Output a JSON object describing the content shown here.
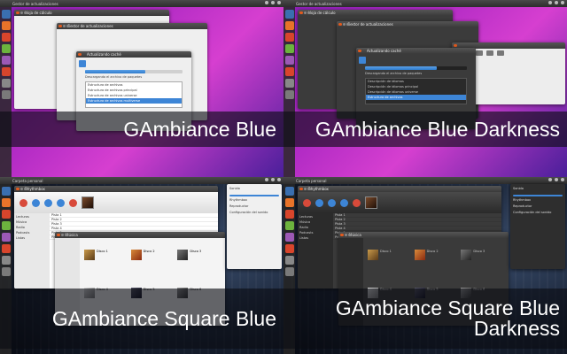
{
  "quadrants": [
    {
      "caption": "GAmbiance Blue",
      "panel_title": "Gestor de actualizaciones",
      "theme": "light",
      "accent": "#3d85d6",
      "window_back_title": "Hoja de cálculo",
      "window_front_title": "Gestor de actualizaciones",
      "dialog_title": "Actualizando caché",
      "dialog_line": "Descargando el archivo de paquetes",
      "list_rows": [
        "Estructura de archivos",
        "Estructura de archivos principal",
        "Estructura de archivos universe",
        "Estructura de archivos multiverse"
      ]
    },
    {
      "caption": "GAmbiance Blue Darkness",
      "panel_title": "Gestor de actualizaciones",
      "theme": "dark",
      "accent": "#3d85d6",
      "window_back_title": "Hoja de cálculo",
      "window_front_title": "Gestor de actualizaciones",
      "dialog_title": "Actualizando caché",
      "dialog_line": "Descargando el archivo de paquetes",
      "list_rows": [
        "Descripción de idiomas",
        "Descripción de idiomas principal",
        "Descripción de idiomas universe",
        "Estructura de archivos"
      ]
    },
    {
      "caption": "GAmbiance Square Blue",
      "panel_title": "Carpeta personal",
      "theme": "light",
      "accent": "#3d85d6",
      "player_title": "Rhythmbox",
      "files_title": "Música",
      "sidebar_rows": [
        "Lecturas",
        "Música",
        "Radio",
        "Podcasts",
        "Listas"
      ],
      "tracks": [
        "Pista 1",
        "Pista 2",
        "Pista 3",
        "Pista 4",
        "Pista 5",
        "Pista 6"
      ],
      "sound_rows": [
        "Sonido",
        "Rhythmbox",
        "Reproductor",
        "Configuración del sonido"
      ],
      "files": [
        "Disco 1",
        "Disco 2",
        "Disco 3",
        "Disco 4",
        "Disco 5",
        "Disco 6"
      ]
    },
    {
      "caption": "GAmbiance Square Blue\nDarkness",
      "panel_title": "Carpeta personal",
      "theme": "dark",
      "accent": "#3d85d6",
      "player_title": "Rhythmbox",
      "files_title": "Música",
      "sidebar_rows": [
        "Lecturas",
        "Música",
        "Radio",
        "Podcasts",
        "Listas"
      ],
      "tracks": [
        "Pista 1",
        "Pista 2",
        "Pista 3",
        "Pista 4",
        "Pista 5",
        "Pista 6"
      ],
      "sound_rows": [
        "Sonido",
        "Rhythmbox",
        "Reproductor",
        "Configuración del sonido"
      ],
      "files": [
        "Disco 1",
        "Disco 2",
        "Disco 3",
        "Disco 4",
        "Disco 5",
        "Disco 6"
      ]
    }
  ],
  "launcher_colors": [
    "#3a6fb0",
    "#e8732a",
    "#d8452c",
    "#6cb33e",
    "#9c59b6",
    "#d8452c",
    "#888888",
    "#4aa3df",
    "#e0b030",
    "#7a7a7a",
    "#c0392b",
    "#5b8ed6"
  ]
}
